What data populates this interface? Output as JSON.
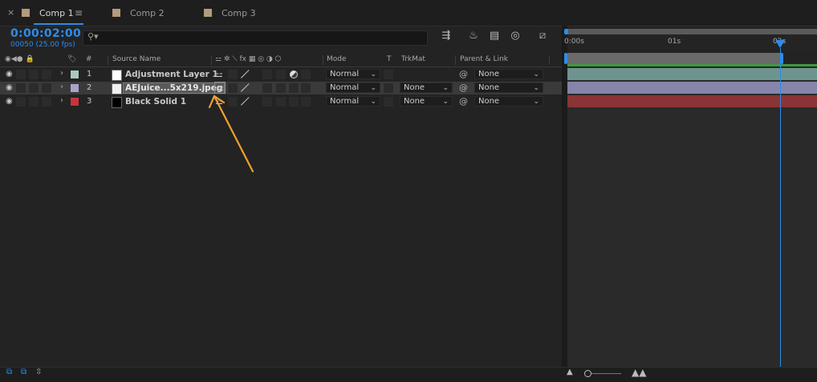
{
  "tabs": [
    {
      "label": "Comp 1",
      "active": true
    },
    {
      "label": "Comp 2",
      "active": false
    },
    {
      "label": "Comp 3",
      "active": false
    }
  ],
  "tab_close_glyph": "×",
  "tab_menu_glyph": "≡",
  "timecode": "0:00:02:00",
  "frames": "00050 (25.00 fps)",
  "search": {
    "icon_glyph": "⚲▾",
    "placeholder": ""
  },
  "toolbar_icons": [
    {
      "name": "composition-flowchart-icon",
      "glyph": "⇶"
    },
    {
      "name": "shy-layers-icon",
      "glyph": "♨"
    },
    {
      "name": "frame-blending-icon",
      "glyph": "▤"
    },
    {
      "name": "motion-blur-icon",
      "glyph": "◎"
    },
    {
      "name": "graph-editor-icon",
      "glyph": "⧄"
    }
  ],
  "columns": {
    "source_name": "Source Name",
    "mode": "Mode",
    "t": "T",
    "trkmat": "TrkMat",
    "parent_link": "Parent & Link",
    "hash": "#",
    "header_icons": "◉◀● 🔒",
    "switches": "⚍ ✲ ⟍ fx ▦ ◎ ◑ ⬡"
  },
  "layers": [
    {
      "num": "1",
      "name": "Adjustment Layer 1",
      "label_color": "#a8c8c0",
      "source_color": "#ffffff",
      "mode": "Normal",
      "trkmat": "",
      "parent": "None",
      "selected": false,
      "highlight": false
    },
    {
      "num": "2",
      "name": "AEJuice...5x219.jpeg",
      "label_color": "#a8a4c8",
      "source_color": "#f0f0f0",
      "mode": "Normal",
      "trkmat": "None",
      "parent": "None",
      "selected": true,
      "highlight": true
    },
    {
      "num": "3",
      "name": "Black Solid 1",
      "label_color": "#c8343c",
      "source_color": "#000000",
      "mode": "Normal",
      "trkmat": "None",
      "parent": "None",
      "selected": false,
      "highlight": false
    }
  ],
  "ruler_ticks": [
    "0:00s",
    "01s",
    "02s"
  ],
  "timeline_bars": [
    "#6e9490",
    "#8684a8",
    "#8a3436"
  ],
  "dropdown_arrow": "⌄",
  "spiral_glyph": "@",
  "chevron_glyph": "›",
  "eye_glyph": "◉",
  "shy_glyph": "⚍",
  "accent_color": "#2d8ceb",
  "annotation_arrow_color": "#f0a030"
}
